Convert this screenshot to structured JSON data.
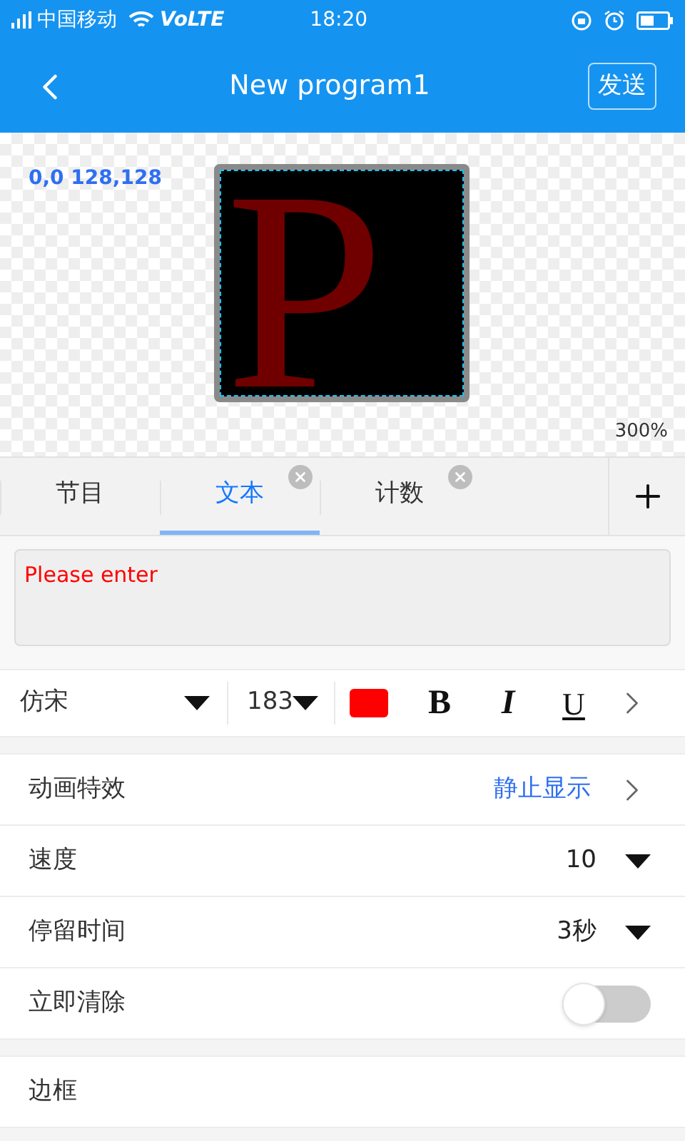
{
  "status_bar": {
    "carrier": "中国移动",
    "network": "VoLTE",
    "time": "18:20"
  },
  "header": {
    "title": "New program1",
    "send": "发送"
  },
  "canvas": {
    "coords": "0,0 128,128",
    "zoom": "300%",
    "preview_text": "P",
    "color": "#700000"
  },
  "tabs": [
    {
      "label": "节目",
      "selected": false,
      "closable": false
    },
    {
      "label": "文本",
      "selected": true,
      "closable": true
    },
    {
      "label": "计数",
      "selected": false,
      "closable": true
    }
  ],
  "text_input": {
    "placeholder": "Please enter"
  },
  "toolbar": {
    "font": "仿宋",
    "size": "183",
    "color": "#ff0000",
    "bold": "B",
    "italic": "I",
    "underline": "U"
  },
  "settings": [
    [
      {
        "kind": "link",
        "label": "动画特效",
        "value": "静止显示"
      },
      {
        "kind": "dropdown",
        "label": "速度",
        "value": "10"
      },
      {
        "kind": "dropdown",
        "label": "停留时间",
        "value": "3秒"
      },
      {
        "kind": "toggle",
        "label": "立即清除",
        "on": false
      }
    ],
    [
      {
        "kind": "plain",
        "label": "边框"
      }
    ]
  ]
}
